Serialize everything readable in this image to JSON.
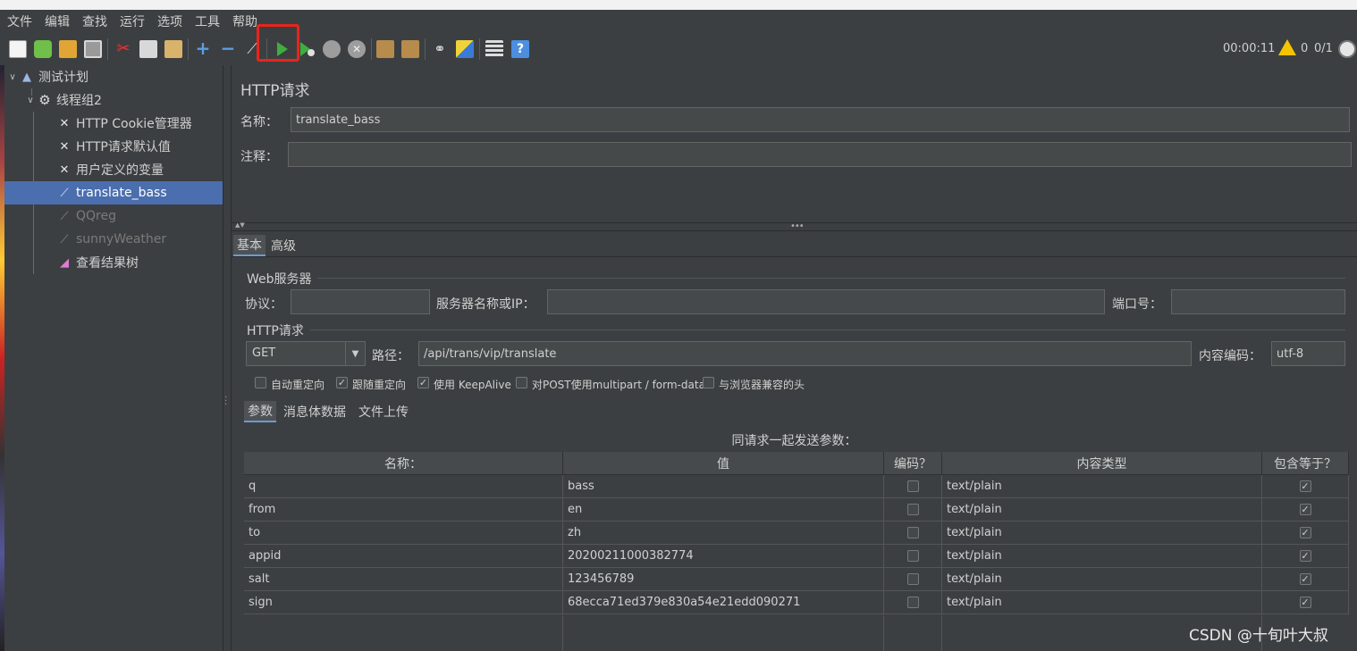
{
  "menu": [
    "文件",
    "编辑",
    "查找",
    "运行",
    "选项",
    "工具",
    "帮助"
  ],
  "toolbar": {
    "timer": "00:00:11",
    "warnings": "0",
    "threads": "0/1"
  },
  "tree": {
    "items": [
      {
        "label": "测试计划",
        "icon": "flask-icon"
      },
      {
        "label": "线程组2",
        "icon": "gear-icon"
      },
      {
        "label": "HTTP Cookie管理器",
        "icon": "wrench-icon"
      },
      {
        "label": "HTTP请求默认值",
        "icon": "wrench-icon"
      },
      {
        "label": "用户定义的变量",
        "icon": "wrench-icon"
      },
      {
        "label": "translate_bass",
        "icon": "pipette-icon"
      },
      {
        "label": "QQreg",
        "icon": "pipette-icon"
      },
      {
        "label": "sunnyWeather",
        "icon": "pipette-icon"
      },
      {
        "label": "查看结果树",
        "icon": "chart-icon"
      }
    ]
  },
  "panel": {
    "title": "HTTP请求",
    "name_label": "名称：",
    "name_value": "translate_bass",
    "comment_label": "注释：",
    "comment_value": "",
    "tabs": [
      "基本",
      "高级"
    ],
    "web_server": {
      "group_title": "Web服务器",
      "protocol_label": "协议：",
      "protocol_value": "",
      "server_label": "服务器名称或IP：",
      "server_value": "",
      "port_label": "端口号：",
      "port_value": ""
    },
    "http_request": {
      "group_title": "HTTP请求",
      "method": "GET",
      "path_label": "路径：",
      "path_value": "/api/trans/vip/translate",
      "encoding_label": "内容编码：",
      "encoding_value": "utf-8"
    },
    "options": [
      {
        "label": "自动重定向",
        "checked": false
      },
      {
        "label": "跟随重定向",
        "checked": true
      },
      {
        "label": "使用 KeepAlive",
        "checked": true
      },
      {
        "label": "对POST使用multipart / form-data",
        "checked": false
      },
      {
        "label": "与浏览器兼容的头",
        "checked": false
      }
    ],
    "sub_tabs": [
      "参数",
      "消息体数据",
      "文件上传"
    ],
    "params_caption": "同请求一起发送参数：",
    "table": {
      "headers": [
        "名称：",
        "值",
        "编码？",
        "内容类型",
        "包含等于？"
      ],
      "rows": [
        {
          "name": "q",
          "value": "bass",
          "encode": false,
          "content_type": "text/plain",
          "include_equals": true
        },
        {
          "name": "from",
          "value": "en",
          "encode": false,
          "content_type": "text/plain",
          "include_equals": true
        },
        {
          "name": "to",
          "value": "zh",
          "encode": false,
          "content_type": "text/plain",
          "include_equals": true
        },
        {
          "name": "appid",
          "value": "20200211000382774",
          "encode": false,
          "content_type": "text/plain",
          "include_equals": true
        },
        {
          "name": "salt",
          "value": "123456789",
          "encode": false,
          "content_type": "text/plain",
          "include_equals": true
        },
        {
          "name": "sign",
          "value": "68ecca71ed379e830a54e21edd090271",
          "encode": false,
          "content_type": "text/plain",
          "include_equals": true
        }
      ]
    }
  },
  "watermark": "CSDN @十旬叶大叔",
  "colors": {
    "background": "#3c3f41",
    "selection": "#4b6eaf",
    "highlight": "#e8251b"
  }
}
